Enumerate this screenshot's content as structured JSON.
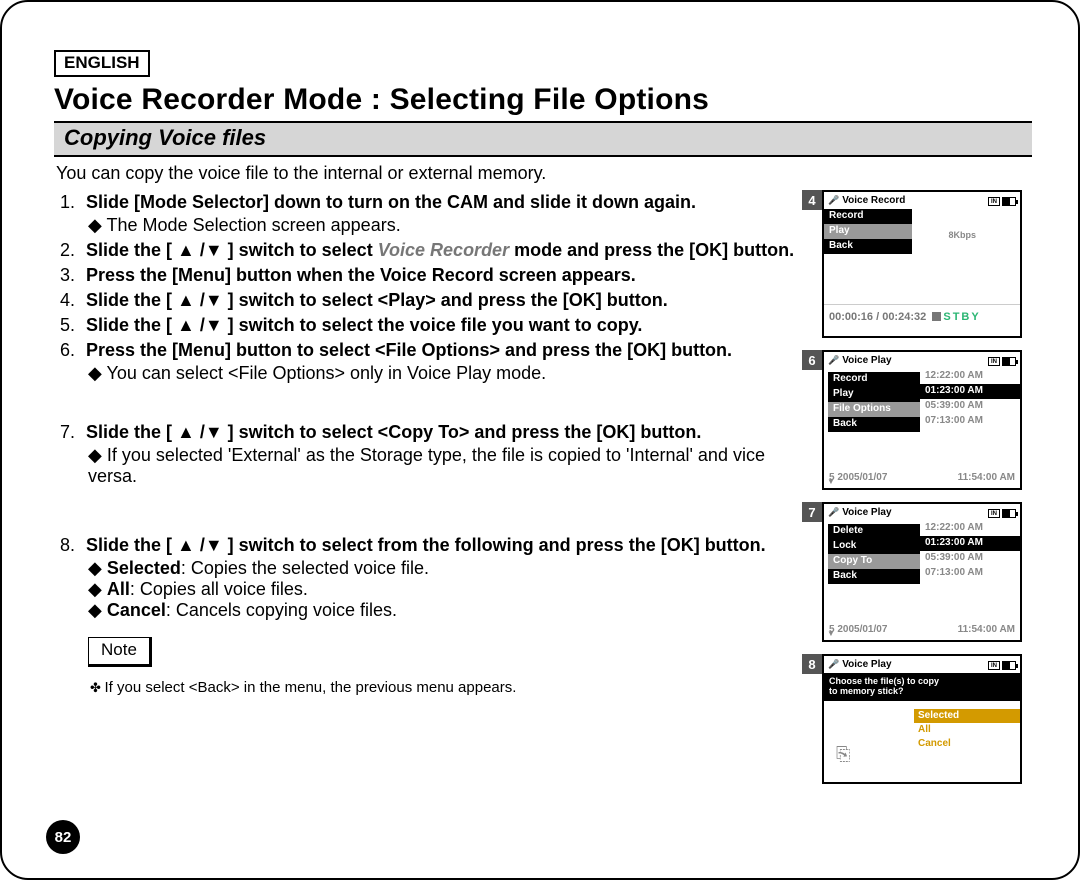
{
  "header": {
    "language": "ENGLISH",
    "title": "Voice Recorder Mode : Selecting File Options",
    "subtitle": "Copying Voice files",
    "intro": "You can copy the voice file to the internal or external memory."
  },
  "steps": [
    {
      "main_a": "Slide [Mode Selector] down to turn on the CAM and slide it down again.",
      "subs": [
        {
          "text": "The Mode Selection screen appears."
        }
      ]
    },
    {
      "main_a": "Slide the [ ▲ /▼ ] switch to select ",
      "ital": "Voice Recorder",
      "main_b": " mode and press the [OK] button."
    },
    {
      "main_a": "Press the [Menu] button when the Voice Record screen appears."
    },
    {
      "main_a": "Slide the [ ▲ /▼ ] switch to select <Play> and press the [OK] button."
    },
    {
      "main_a": "Slide the [ ▲ /▼ ] switch to select the voice file you want to copy."
    },
    {
      "main_a": "Press the [Menu] button to select <File Options> and press the [OK] button.",
      "subs": [
        {
          "text": "You can select <File Options> only in Voice Play mode."
        }
      ]
    },
    {
      "main_a": "Slide the [ ▲ /▼ ] switch to select <Copy To> and press the [OK] button.",
      "subs": [
        {
          "text": "If you selected 'External' as the Storage type, the file is copied to 'Internal' and vice versa."
        }
      ]
    },
    {
      "main_a": "Slide the [ ▲ /▼ ] switch to select from the following and press the [OK] button.",
      "subs": [
        {
          "label": "Selected",
          "text": ": Copies the selected voice file."
        },
        {
          "label": "All",
          "text": ": Copies all voice files."
        },
        {
          "label": "Cancel",
          "text": ": Cancels copying voice files."
        }
      ]
    }
  ],
  "note": {
    "heading": "Note",
    "items": [
      "If you select <Back> in the menu, the previous menu appears."
    ]
  },
  "page_number": "82",
  "figs": {
    "f4": {
      "num": "4",
      "title": "Voice Record",
      "menu": [
        "Record",
        "Play",
        "Back"
      ],
      "sel": 1,
      "rate": "8Kbps",
      "time": "00:00:16 / 00:24:32",
      "status": "STBY"
    },
    "f6": {
      "num": "6",
      "title": "Voice Play",
      "menu": [
        "Record",
        "Play",
        "File Options",
        "Back"
      ],
      "sel": 2,
      "rows": [
        {
          "t": "12:22:00 AM"
        },
        {
          "t": "01:23:00 AM",
          "sel": true
        },
        {
          "t": "05:39:00 AM"
        },
        {
          "t": "07:13:00 AM"
        }
      ],
      "tail_date": "5   2005/01/07",
      "tail_time": "11:54:00 AM"
    },
    "f7": {
      "num": "7",
      "title": "Voice Play",
      "menu": [
        "Delete",
        "Lock",
        "Copy To",
        "Back"
      ],
      "sel": 2,
      "rows": [
        {
          "t": "12:22:00 AM"
        },
        {
          "t": "01:23:00 AM",
          "sel": true
        },
        {
          "t": "05:39:00 AM"
        },
        {
          "t": "07:13:00 AM"
        }
      ],
      "tail_date": "5   2005/01/07",
      "tail_time": "11:54:00 AM"
    },
    "f8": {
      "num": "8",
      "title": "Voice Play",
      "ask1": "Choose the file(s) to copy",
      "ask2": "to memory stick?",
      "options": [
        "Selected",
        "All",
        "Cancel"
      ],
      "sel": 0
    }
  }
}
